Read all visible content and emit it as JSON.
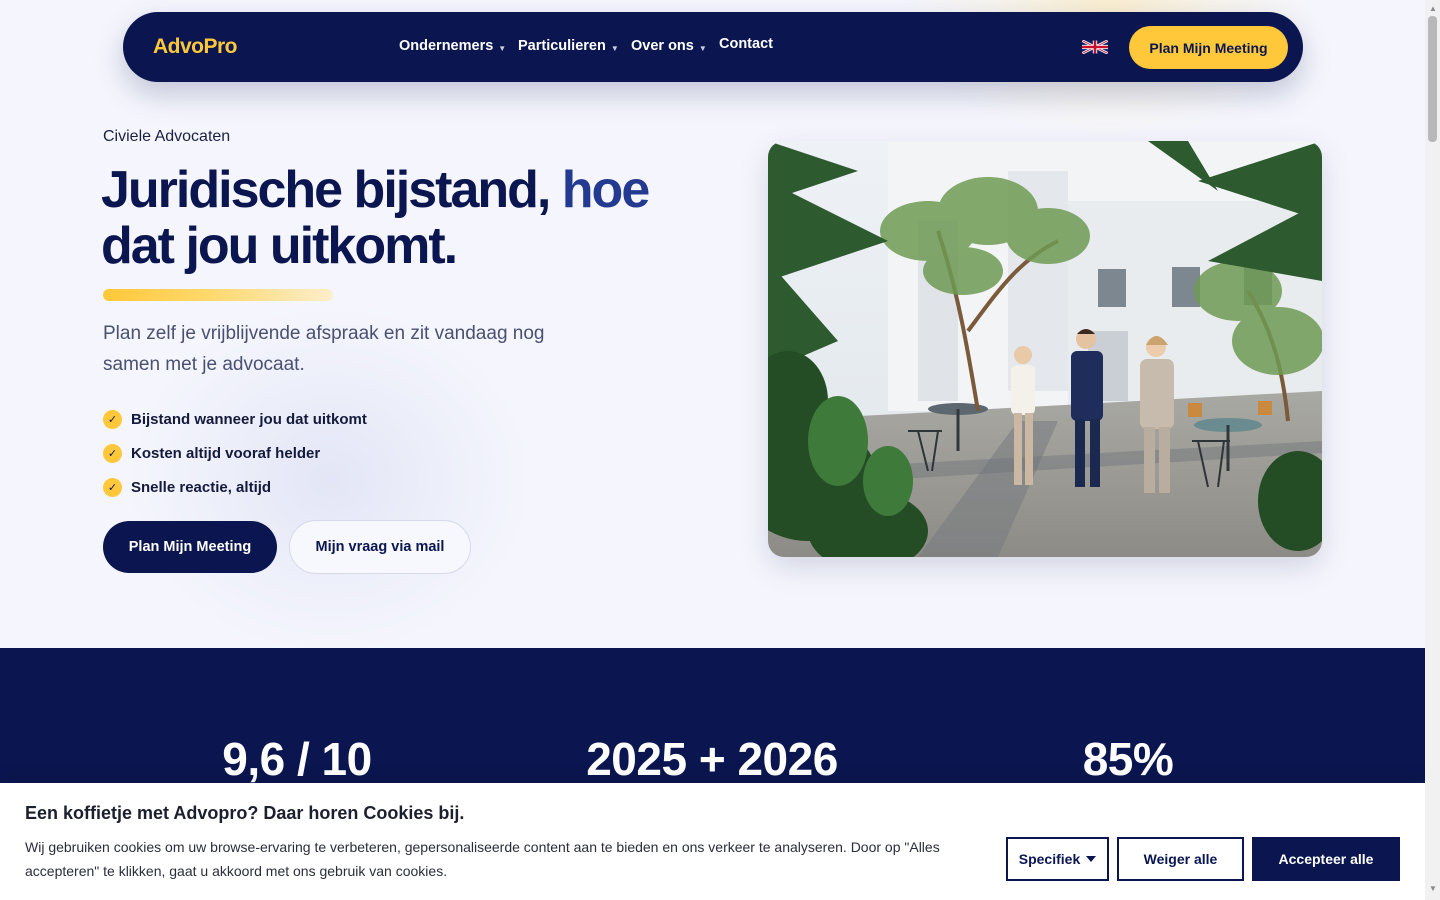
{
  "nav": {
    "logo": "AdvoPro",
    "items": [
      {
        "label": "Ondernemers",
        "dropdown": true
      },
      {
        "label": "Particulieren",
        "dropdown": true
      },
      {
        "label": "Over ons",
        "dropdown": true
      },
      {
        "label": "Contact",
        "dropdown": false
      }
    ],
    "language_icon": "uk-flag-icon",
    "cta_label": "Plan Mijn Meeting"
  },
  "hero": {
    "eyebrow": "Civiele Advocaten",
    "headline_part1": "Juridische bijstand,",
    "headline_part2": "hoe",
    "headline_part3": "dat jou uitkomt.",
    "lead": "Plan zelf je vrijblijvende afspraak en zit vandaag nog samen met je advocaat.",
    "checks": [
      "Bijstand wanneer jou dat uitkomt",
      "Kosten altijd vooraf helder",
      "Snelle reactie, altijd"
    ],
    "primary_button": "Plan Mijn Meeting",
    "secondary_button": "Mijn vraag via mail"
  },
  "stats": [
    "9,6 / 10",
    "2025 + 2026",
    "85%"
  ],
  "cookie": {
    "title": "Een koffietje met Advopro? Daar horen Cookies bij.",
    "text": "Wij gebruiken cookies om uw browse-ervaring te verbeteren, gepersonaliseerde content aan te bieden en ons verkeer te analyseren. Door op \"Alles accepteren\" te klikken, gaat u akkoord met ons gebruik van cookies.",
    "specific_label": "Specifiek",
    "reject_label": "Weiger alle",
    "accept_label": "Accepteer alle"
  },
  "colors": {
    "navy": "#0b1650",
    "accent_blue": "#243a91",
    "gold": "#ffc83a",
    "background": "#f5f6fd"
  }
}
